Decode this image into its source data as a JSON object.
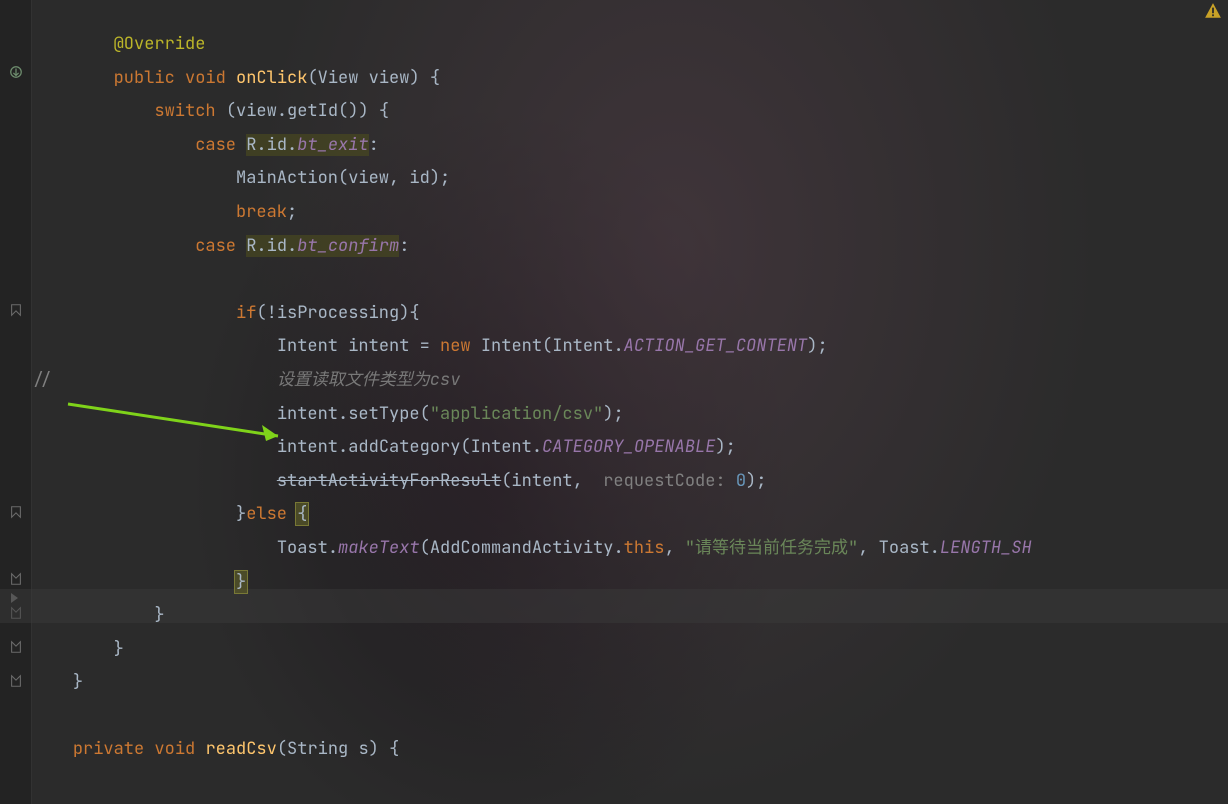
{
  "annotations": {
    "override": "@Override"
  },
  "keywords": {
    "public": "public",
    "void": "void",
    "switch": "switch",
    "case": "case",
    "break": "break",
    "if": "if",
    "new": "new",
    "else": "else",
    "this": "this",
    "private": "private"
  },
  "identifiers": {
    "onClick": "onClick",
    "View": "View",
    "view": "view",
    "getId": "getId",
    "R": "R",
    "id_ref": "id",
    "bt_exit": "bt_exit",
    "bt_confirm": "bt_confirm",
    "MainAction": "MainAction",
    "id_var": "id",
    "isProcessing": "isProcessing",
    "Intent": "Intent",
    "intent": "intent",
    "ACTION_GET_CONTENT": "ACTION_GET_CONTENT",
    "setType": "setType",
    "addCategory": "addCategory",
    "CATEGORY_OPENABLE": "CATEGORY_OPENABLE",
    "startActivityForResult": "startActivityForResult",
    "Toast": "Toast",
    "makeText": "makeText",
    "AddCommandActivity": "AddCommandActivity",
    "LENGTH_SH": "LENGTH_SH",
    "readCsv": "readCsv",
    "String": "String",
    "s": "s"
  },
  "strings": {
    "app_csv": "\"application/csv\"",
    "wait_msg": "\"请等待当前任务完成\""
  },
  "comments": {
    "slashes": "//",
    "set_csv": "设置读取文件类型为csv"
  },
  "params": {
    "requestCode": "requestCode: "
  },
  "numbers": {
    "zero": "0"
  },
  "punct": {
    "lparen": "(",
    "rparen": ")",
    "lbrace": "{",
    "rbrace": "}",
    "semi": ";",
    "comma": ",",
    "dot": ".",
    "colon": ":",
    "bang": "!",
    "eq": "="
  }
}
